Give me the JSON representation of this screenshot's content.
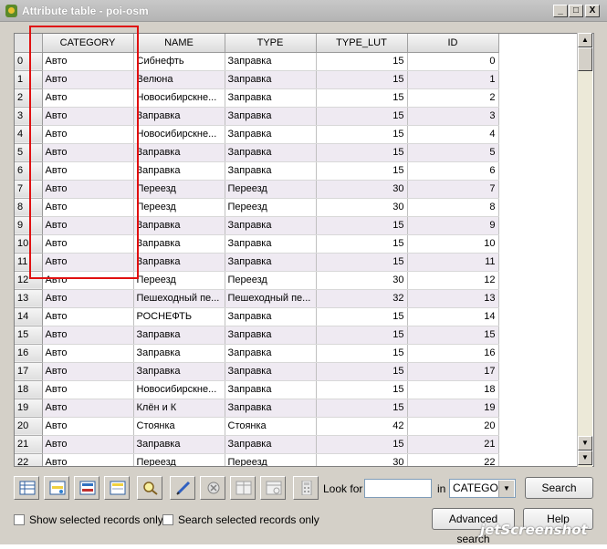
{
  "window": {
    "title": "Attribute table - poi-osm",
    "controls": {
      "minimize": "_",
      "maximize": "□",
      "close": "X"
    }
  },
  "table": {
    "headers": [
      "CATEGORY",
      "NAME",
      "TYPE",
      "TYPE_LUT",
      "ID"
    ],
    "sorted_column": "CATEGORY",
    "sort_icon": "sort-arrow-icon",
    "rows": [
      [
        "0",
        "Авто",
        "Сибнефть",
        "Заправка",
        "15",
        "0"
      ],
      [
        "1",
        "Авто",
        "Велюна",
        "Заправка",
        "15",
        "1"
      ],
      [
        "2",
        "Авто",
        "Новосибирскне...",
        "Заправка",
        "15",
        "2"
      ],
      [
        "3",
        "Авто",
        "Заправка",
        "Заправка",
        "15",
        "3"
      ],
      [
        "4",
        "Авто",
        "Новосибирскне...",
        "Заправка",
        "15",
        "4"
      ],
      [
        "5",
        "Авто",
        "Заправка",
        "Заправка",
        "15",
        "5"
      ],
      [
        "6",
        "Авто",
        "Заправка",
        "Заправка",
        "15",
        "6"
      ],
      [
        "7",
        "Авто",
        "Переезд",
        "Переезд",
        "30",
        "7"
      ],
      [
        "8",
        "Авто",
        "Переезд",
        "Переезд",
        "30",
        "8"
      ],
      [
        "9",
        "Авто",
        "Заправка",
        "Заправка",
        "15",
        "9"
      ],
      [
        "10",
        "Авто",
        "Заправка",
        "Заправка",
        "15",
        "10"
      ],
      [
        "11",
        "Авто",
        "Заправка",
        "Заправка",
        "15",
        "11"
      ],
      [
        "12",
        "Авто",
        "Переезд",
        "Переезд",
        "30",
        "12"
      ],
      [
        "13",
        "Авто",
        "Пешеходный пе...",
        "Пешеходный пе...",
        "32",
        "13"
      ],
      [
        "14",
        "Авто",
        "РОСНЕФТЬ",
        "Заправка",
        "15",
        "14"
      ],
      [
        "15",
        "Авто",
        "Заправка",
        "Заправка",
        "15",
        "15"
      ],
      [
        "16",
        "Авто",
        "Заправка",
        "Заправка",
        "15",
        "16"
      ],
      [
        "17",
        "Авто",
        "Заправка",
        "Заправка",
        "15",
        "17"
      ],
      [
        "18",
        "Авто",
        "Новосибирскне...",
        "Заправка",
        "15",
        "18"
      ],
      [
        "19",
        "Авто",
        "Клён и К",
        "Заправка",
        "15",
        "19"
      ],
      [
        "20",
        "Авто",
        "Стоянка",
        "Стоянка",
        "42",
        "20"
      ],
      [
        "21",
        "Авто",
        "Заправка",
        "Заправка",
        "15",
        "21"
      ],
      [
        "22",
        "Авто",
        "Переезд",
        "Переезд",
        "30",
        "22"
      ]
    ]
  },
  "toolbar": {
    "icons": [
      "table-icon",
      "select-icon",
      "invert-selection-icon",
      "move-to-top-icon",
      "zoom-to-selection-icon",
      "edit-pencil-icon",
      "delete-icon",
      "new-column-icon",
      "delete-column-icon",
      "calculator-icon"
    ],
    "look_for_label": "Look for",
    "look_for_value": "",
    "in_label": "in",
    "column_select_value": "CATEGOR",
    "search_button": "Search",
    "advanced_search_button": "Advanced search",
    "help_button": "Help"
  },
  "options": {
    "show_selected_label": "Show selected records only",
    "search_selected_label": "Search selected records only"
  },
  "watermark": "jetScreenshot",
  "colors": {
    "highlight": "#e01010",
    "alt_row": "#efeaf2"
  }
}
